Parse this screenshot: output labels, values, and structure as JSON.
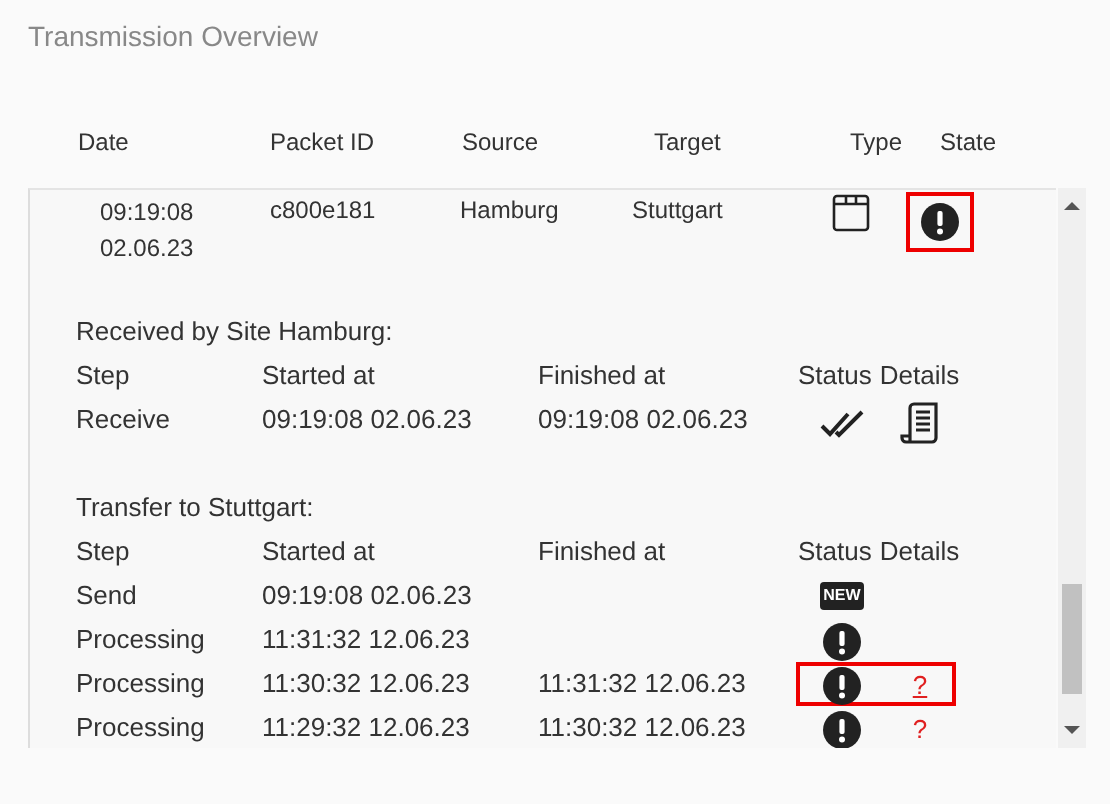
{
  "title": "Transmission Overview",
  "columns": [
    "Date",
    "Packet ID",
    "Source",
    "Target",
    "Type",
    "State"
  ],
  "packet": {
    "date": [
      "09:19:08",
      "02.06.23"
    ],
    "packet_id": "c800e181",
    "source": "Hamburg",
    "target": "Stuttgart",
    "type": {
      "kind": "window"
    },
    "state": {
      "kind": "alert",
      "highlighted": true
    }
  },
  "sections": [
    {
      "title": "Received by Site Hamburg:",
      "columns": [
        "Step",
        "Started at",
        "Finished at",
        "Status",
        "Details"
      ],
      "rows": [
        {
          "step": "Receive",
          "started": "09:19:08 02.06.23",
          "finished": "09:19:08 02.06.23",
          "status": {
            "kind": "done"
          },
          "details": {
            "kind": "document"
          },
          "highlighted": false
        }
      ]
    },
    {
      "title": "Transfer to Stuttgart:",
      "columns": [
        "Step",
        "Started at",
        "Finished at",
        "Status",
        "Details"
      ],
      "rows": [
        {
          "step": "Send",
          "started": "09:19:08 02.06.23",
          "status": {
            "kind": "new",
            "text": "NEW"
          },
          "highlighted": false
        },
        {
          "step": "Processing",
          "started": "11:31:32 12.06.23",
          "status": {
            "kind": "alert"
          },
          "highlighted": false
        },
        {
          "step": "Processing",
          "started": "11:30:32 12.06.23",
          "finished": "11:31:32 12.06.23",
          "status": {
            "kind": "alert"
          },
          "details": {
            "kind": "link",
            "text": "?"
          },
          "highlighted": true
        },
        {
          "step": "Processing",
          "started": "11:29:32 12.06.23",
          "finished": "11:30:32 12.06.23",
          "status": {
            "kind": "alert"
          },
          "details": {
            "kind": "link",
            "text": "?"
          },
          "highlighted": false
        }
      ]
    }
  ]
}
